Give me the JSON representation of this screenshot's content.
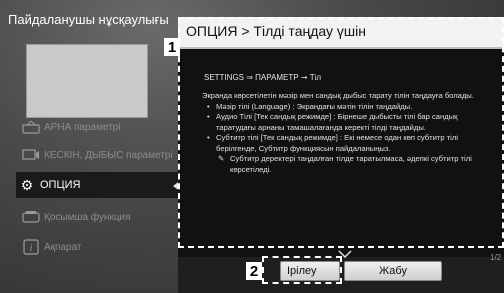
{
  "sidebar": {
    "title": "Пайдаланушы нұсқаулығы",
    "items": [
      {
        "label": "АРНА параметрі",
        "icon": "antenna-icon"
      },
      {
        "label": "КЕСКІН, ДЫБЫС параметрі",
        "icon": "picture-sound-icon"
      },
      {
        "label": "ОПЦИЯ",
        "icon": "gear-icon"
      },
      {
        "label": "Қосымша функция",
        "icon": "plus-function-icon"
      },
      {
        "label": "Ақпарат",
        "icon": "info-icon"
      }
    ]
  },
  "dialog": {
    "title": "ОПЦИЯ > Тілді таңдау үшін",
    "path": "SETTINGS ⇒ ПАРАМЕТР ➞ Тіл",
    "intro": "Экранда көрсетілетін мәзір мен сандық дыбыс тарату тілін таңдауға болады.",
    "bullets": [
      "Мәзір тілі (Language) : Экрандағы мәтін тілін таңдайды.",
      "Аудио Тілі [Тек сандық режимде] : Бірнеше дыбысты тілі бар сандық таратудағы арнаны тамашалағанда керекті тілді таңдайды.",
      "Субтитр тілі [Тек сандық режимде] : Екі немесе одан көп субтитр тілі берілгенде, Субтитр функциясын пайдаланыңыз."
    ],
    "note": "Субтитр деректері таңдалған тілде таратылмаса, әдепкі субтитр тілі көрсетіледі.",
    "page_indicator": "1/2",
    "buttons": {
      "listen": "Ірілеу",
      "close": "Жабу"
    }
  },
  "callouts": {
    "one": "1",
    "two": "2"
  }
}
